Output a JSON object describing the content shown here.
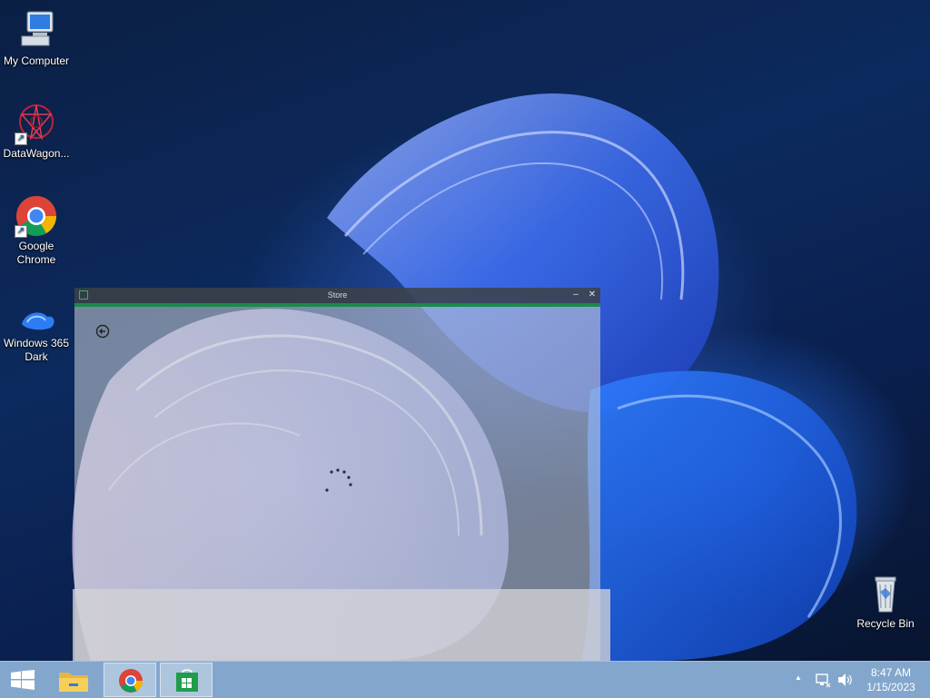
{
  "desktop": {
    "icons": [
      {
        "label": "My Computer",
        "icon": "computer-icon"
      },
      {
        "label": "DataWagon...",
        "icon": "datawagon-icon"
      },
      {
        "label": "Google Chrome",
        "icon": "chrome-icon"
      },
      {
        "label": "Windows 365 Dark",
        "icon": "windows365-icon"
      },
      {
        "label": "Recycle Bin",
        "icon": "recycle-bin-icon"
      }
    ]
  },
  "store_window": {
    "title": "Store",
    "minimize": "–",
    "close": "✕",
    "back_icon": "back-arrow-icon",
    "accent": "#1a8a4a"
  },
  "taskbar": {
    "start_icon": "windows-start-icon",
    "pinned": [
      "file-explorer-icon",
      "chrome-icon",
      "store-icon"
    ],
    "tray": {
      "overflow": "▲",
      "network_icon": "network-icon",
      "volume_icon": "volume-icon"
    },
    "clock": {
      "time": "8:47 AM",
      "date": "1/15/2023"
    }
  }
}
